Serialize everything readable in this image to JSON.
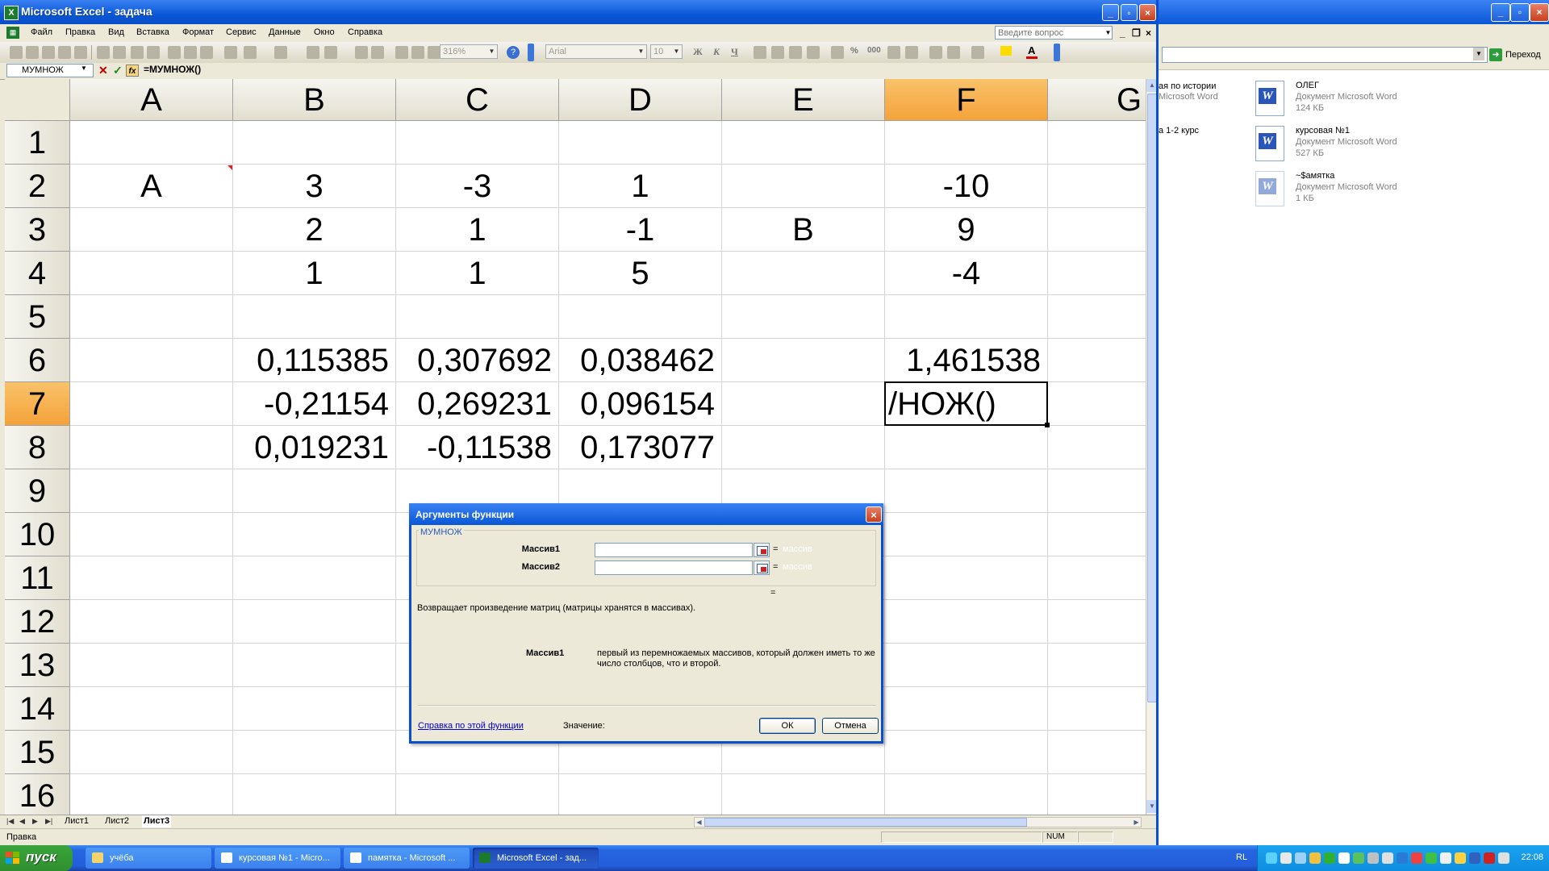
{
  "explorer": {
    "go_button": "Переход",
    "left_items": [
      "ая по истории",
      "Microsoft Word",
      "а 1-2 курс"
    ],
    "files": [
      {
        "name": "ОЛЕГ",
        "type": "Документ Microsoft Word",
        "size": "124 КБ"
      },
      {
        "name": "курсовая №1",
        "type": "Документ Microsoft Word",
        "size": "527 КБ"
      },
      {
        "name": "~$амятка",
        "type": "Документ Microsoft Word",
        "size": "1 КБ"
      }
    ]
  },
  "excel": {
    "title": "Microsoft Excel - задача",
    "menu": [
      "Файл",
      "Правка",
      "Вид",
      "Вставка",
      "Формат",
      "Сервис",
      "Данные",
      "Окно",
      "Справка"
    ],
    "help_placeholder": "Введите вопрос",
    "zoom": "316%",
    "font_name": "Arial",
    "font_size": "10",
    "format_letters": [
      "Ж",
      "К",
      "Ч"
    ],
    "percent": "%",
    "thousands": "000",
    "name_box": "МУМНОЖ",
    "formula": "=МУМНОЖ()",
    "columns": [
      "A",
      "B",
      "C",
      "D",
      "E",
      "F",
      "G"
    ],
    "selected_column": "F",
    "rows": [
      "1",
      "2",
      "3",
      "4",
      "5",
      "6",
      "7",
      "8",
      "9",
      "10",
      "11",
      "12",
      "13",
      "14",
      "15",
      "16"
    ],
    "selected_row": "7",
    "cells": {
      "A2": "A",
      "B2": "3",
      "C2": "-3",
      "D2": "1",
      "F2": "-10",
      "B3": "2",
      "C3": "1",
      "D3": "-1",
      "E3": "B",
      "F3": "9",
      "B4": "1",
      "C4": "1",
      "D4": "5",
      "F4": "-4",
      "B6": "0,115385",
      "C6": "0,307692",
      "D6": "0,038462",
      "F6": "1,461538",
      "B7": "-0,21154",
      "C7": "0,269231",
      "D7": "0,096154",
      "F7": "/НОЖ()",
      "B8": "0,019231",
      "C8": "-0,11538",
      "D8": "0,173077"
    },
    "sheets": [
      "Лист1",
      "Лист2",
      "Лист3"
    ],
    "active_sheet": "Лист3",
    "status_text": "Правка",
    "status_num": "NUM"
  },
  "dialog": {
    "title": "Аргументы функции",
    "function_name": "МУМНОЖ",
    "arg1_label": "Массив1",
    "arg2_label": "Массив2",
    "arg_result": "массив",
    "equals": "=",
    "description": "Возвращает произведение матриц (матрицы хранятся в массивах).",
    "arg_desc_label": "Массив1",
    "arg_desc_text": "первый из перемножаемых массивов, который должен иметь то же число столбцов, что и второй.",
    "help_link": "Справка по этой функции",
    "value_label": "Значение:",
    "ok": "ОК",
    "cancel": "Отмена"
  },
  "taskbar": {
    "start": "пуск",
    "tasks": [
      "учёба",
      "курсовая №1 - Micro...",
      "памятка - Microsoft ...",
      "Microsoft Excel - зад..."
    ],
    "lang": "RL",
    "clock": "22:08"
  },
  "colors": {
    "xp_blue": "#0a57d6",
    "selected_header": "#f4a23a",
    "start_green": "#2f8f2f"
  }
}
